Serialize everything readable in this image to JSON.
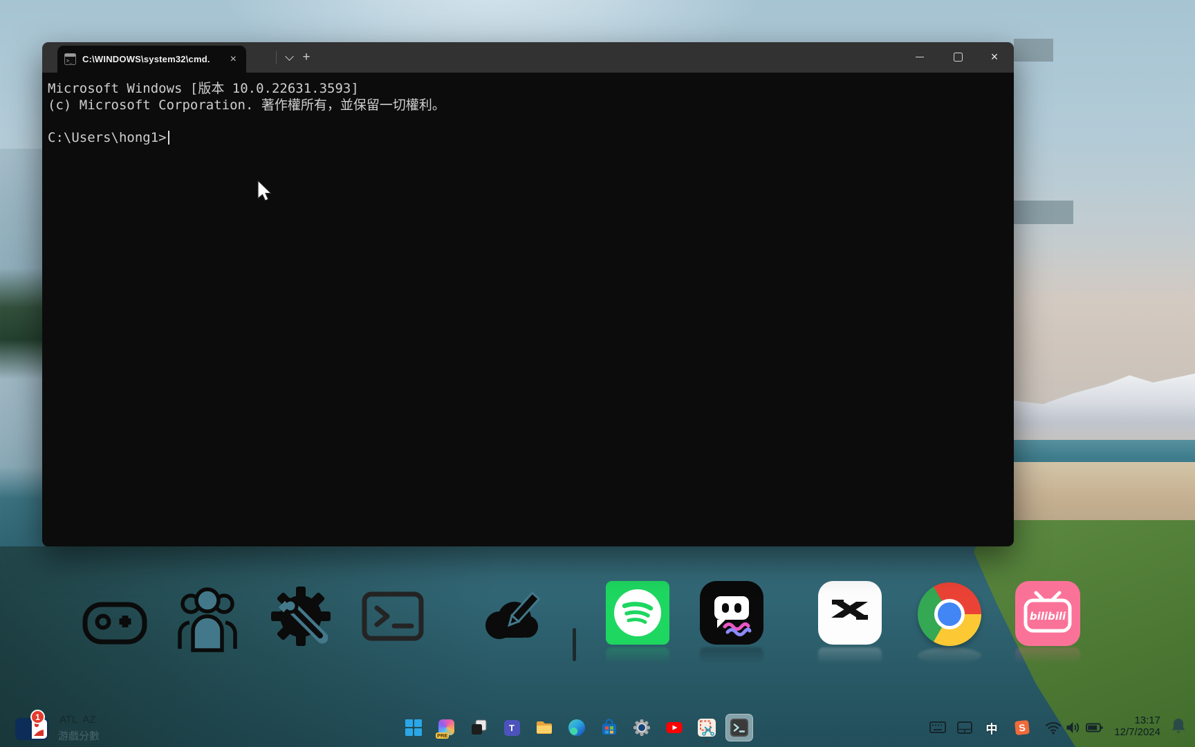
{
  "desktop": {
    "wallpaper": "windows-11-lake-landscape",
    "ghost_panels": 2
  },
  "window": {
    "app": "Windows Terminal",
    "tab": {
      "title": "C:\\WINDOWS\\system32\\cmd.",
      "close_glyph": "×"
    },
    "new_tab_glyph": "+",
    "controls": {
      "close_glyph": "×"
    }
  },
  "terminal": {
    "line1": "Microsoft Windows [版本 10.0.22631.3593]",
    "line2": "(c) Microsoft Corporation. 著作權所有，並保留一切權利。",
    "prompt": "C:\\Users\\hong1>"
  },
  "dock": {
    "items": [
      "gamepad",
      "people-group",
      "gear-wrench",
      "terminal-outline",
      "cloud-pencil",
      "divider",
      "spotify",
      "robot-chat",
      "capcut",
      "chrome",
      "bilibili"
    ],
    "bilibili_label": "bilibili"
  },
  "taskbar": {
    "items": [
      "start",
      "copilot",
      "task-view",
      "teams",
      "file-explorer",
      "edge",
      "microsoft-store",
      "settings",
      "youtube",
      "snipping-tool",
      "terminal"
    ],
    "copilot_badge": "PRE",
    "teams_letter": "T",
    "active_item": "terminal"
  },
  "tray": {
    "ime_indicator": "中",
    "sogou_letter": "S",
    "time": "13:17",
    "date": "12/7/2024"
  },
  "widget": {
    "badge_count": "1",
    "teams": "ATL  AZ",
    "label": "游戲分數"
  },
  "colors": {
    "terminal_bg": "#0c0c0c",
    "titlebar_bg": "#323232",
    "terminal_text": "#cfcfcf",
    "spotify_green": "#1ed760",
    "bilibili_pink": "#fb7299",
    "youtube_red": "#ff0000",
    "sogou_orange": "#f06a3a",
    "badge_red": "#e33b2e",
    "water_teal": "#2f6573"
  }
}
